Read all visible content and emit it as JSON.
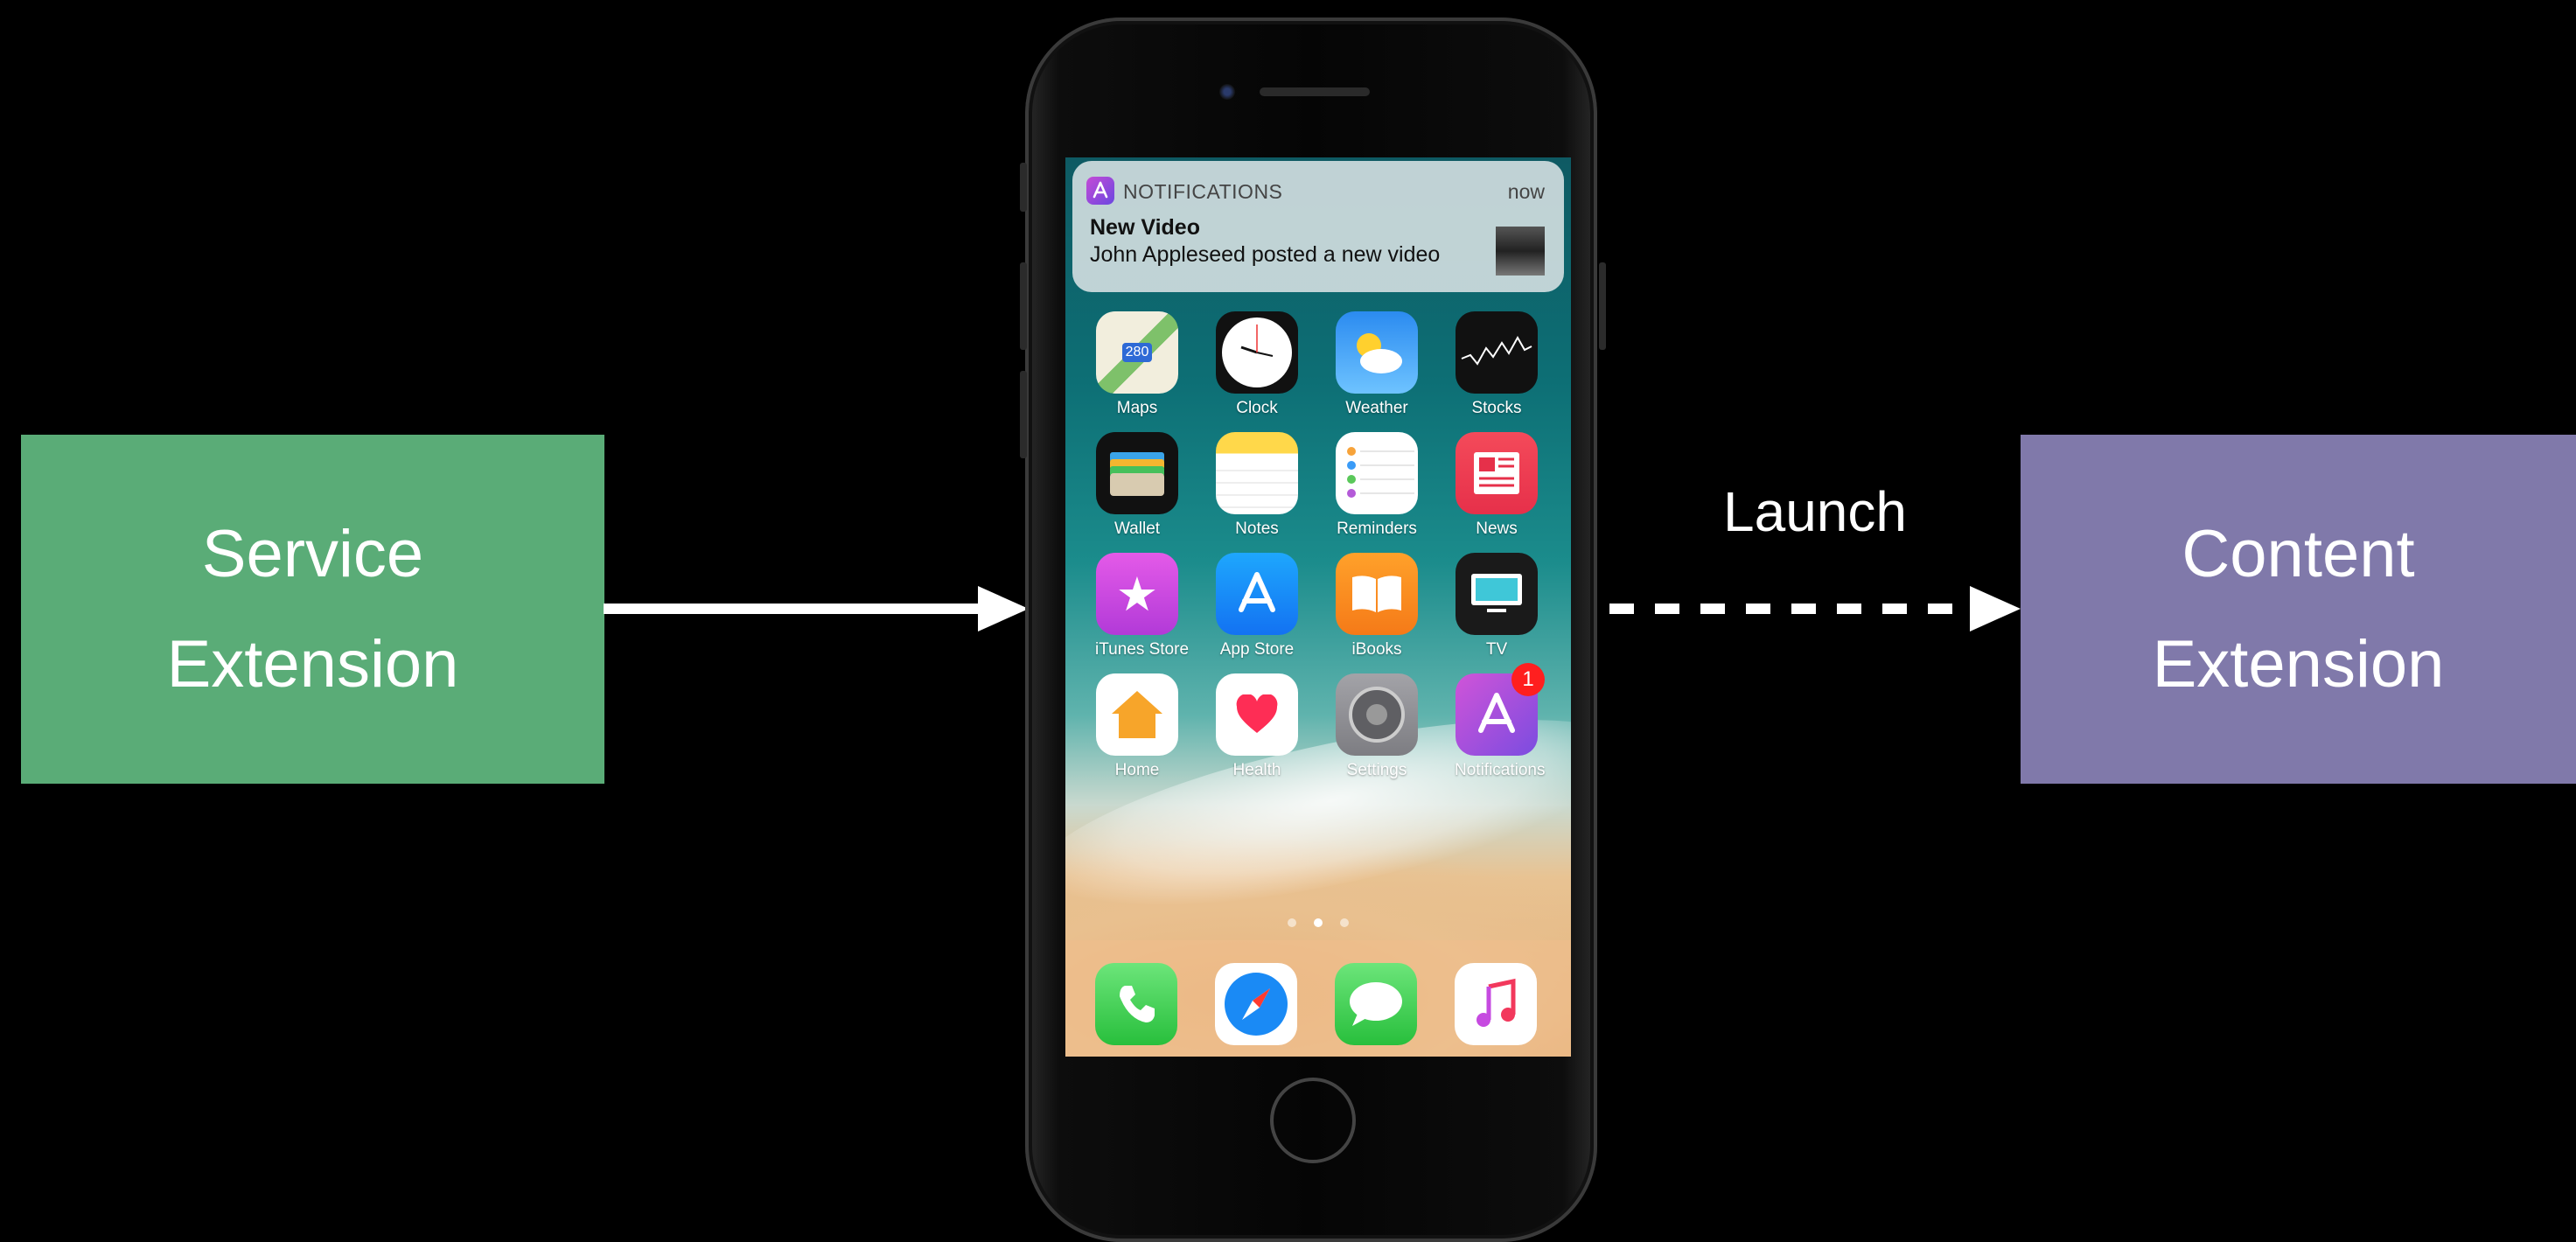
{
  "diagram": {
    "service_box": {
      "line1": "Service",
      "line2": "Extension",
      "color": "#5aac77"
    },
    "content_box": {
      "line1": "Content",
      "line2": "Extension",
      "color": "#8079aa"
    },
    "launch_label": "Launch"
  },
  "notification": {
    "app_name": "NOTIFICATIONS",
    "time": "now",
    "title": "New Video",
    "body": "John Appleseed posted a new video"
  },
  "apps": [
    {
      "label": "Maps",
      "icon": "maps-icon"
    },
    {
      "label": "Clock",
      "icon": "clock-icon"
    },
    {
      "label": "Weather",
      "icon": "weather-icon"
    },
    {
      "label": "Stocks",
      "icon": "stocks-icon"
    },
    {
      "label": "Wallet",
      "icon": "wallet-icon"
    },
    {
      "label": "Notes",
      "icon": "notes-icon"
    },
    {
      "label": "Reminders",
      "icon": "reminders-icon"
    },
    {
      "label": "News",
      "icon": "news-icon"
    },
    {
      "label": "iTunes Store",
      "icon": "itunes-store-icon"
    },
    {
      "label": "App Store",
      "icon": "app-store-icon"
    },
    {
      "label": "iBooks",
      "icon": "ibooks-icon"
    },
    {
      "label": "TV",
      "icon": "tv-icon"
    },
    {
      "label": "Home",
      "icon": "home-icon"
    },
    {
      "label": "Health",
      "icon": "health-icon"
    },
    {
      "label": "Settings",
      "icon": "settings-icon"
    },
    {
      "label": "Notifications",
      "icon": "notifications-app-icon",
      "badge": "1"
    }
  ],
  "map_icon_text": "280",
  "dock": [
    "phone-icon",
    "safari-icon",
    "messages-icon",
    "music-icon"
  ],
  "page_indicator": {
    "count": 3,
    "active": 2
  }
}
